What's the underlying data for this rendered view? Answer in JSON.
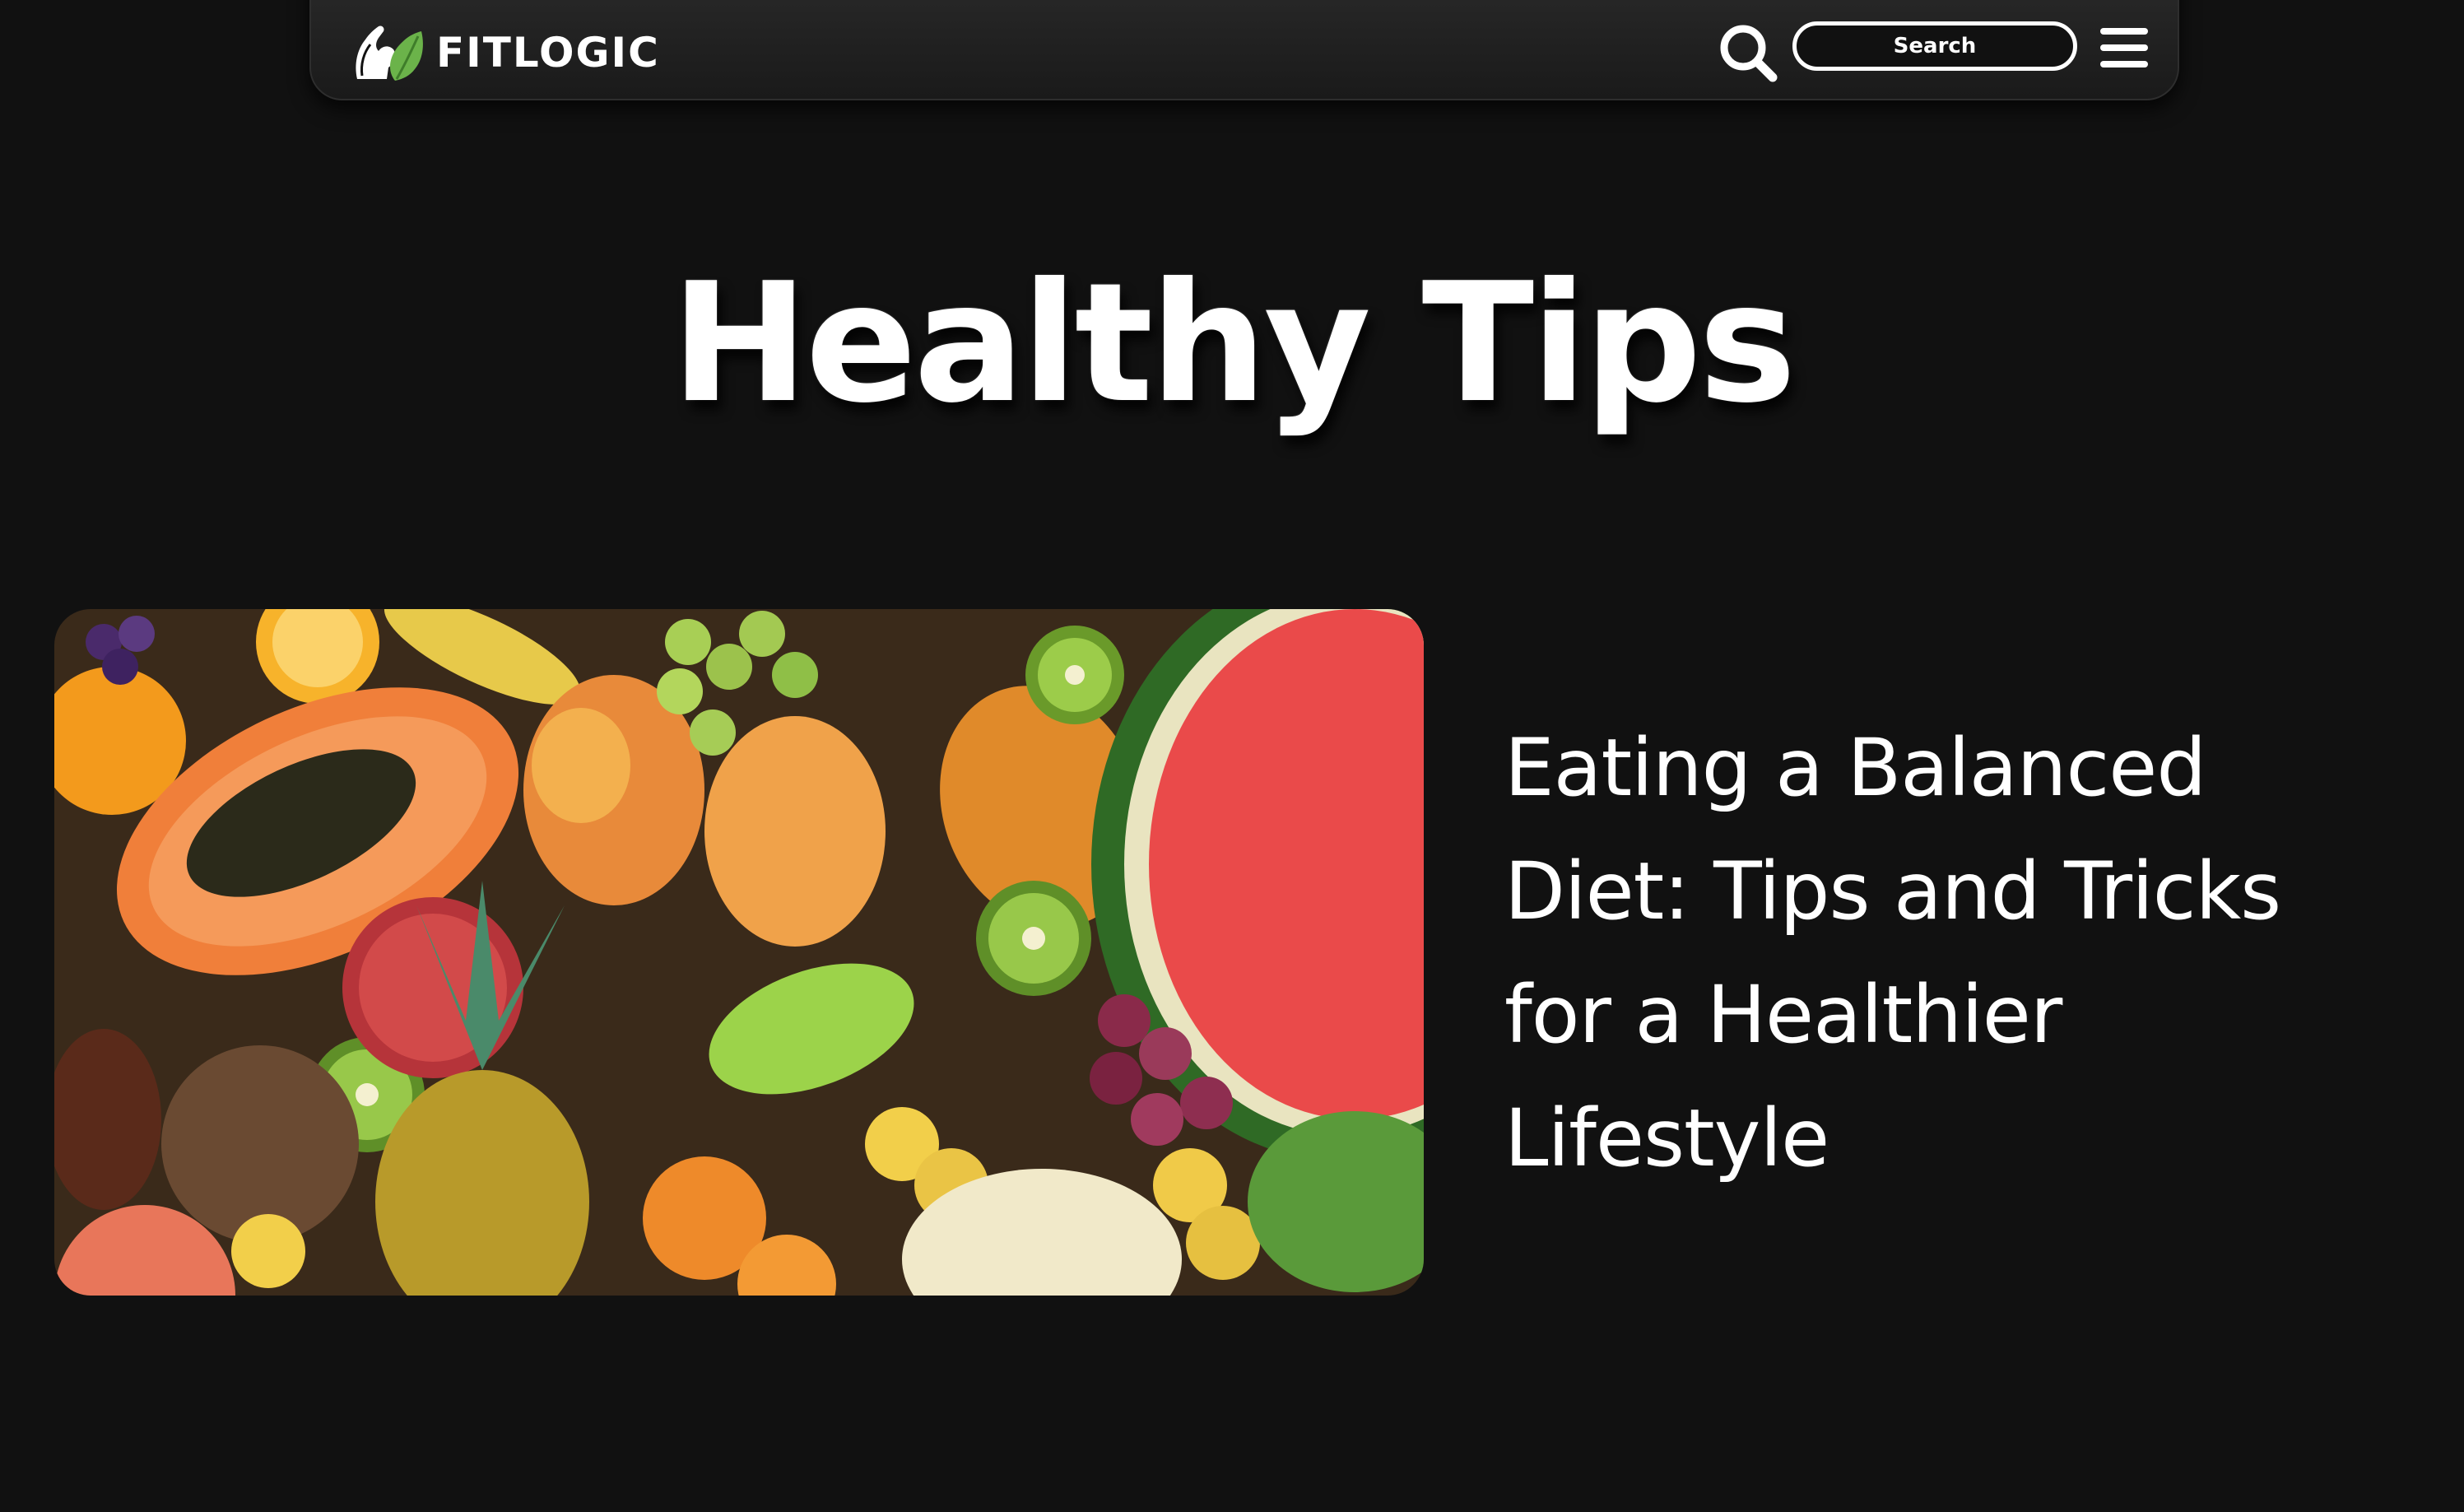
{
  "header": {
    "brand": "FITLOGIC",
    "search_placeholder": "Search",
    "icons": [
      "biceps-leaf-logo",
      "search-icon",
      "hamburger-menu-icon"
    ]
  },
  "hero": {
    "title": "Healthy Tips"
  },
  "article": {
    "title": "Eating a Balanced Diet: Tips and Tricks for a Healthier Lifestyle",
    "image_subject": "assorted-tropical-fruits-photo"
  },
  "colors": {
    "background": "#111111",
    "navbar": "#1c1c1c",
    "text": "#ffffff",
    "leaf_green": "#6bb34a"
  }
}
